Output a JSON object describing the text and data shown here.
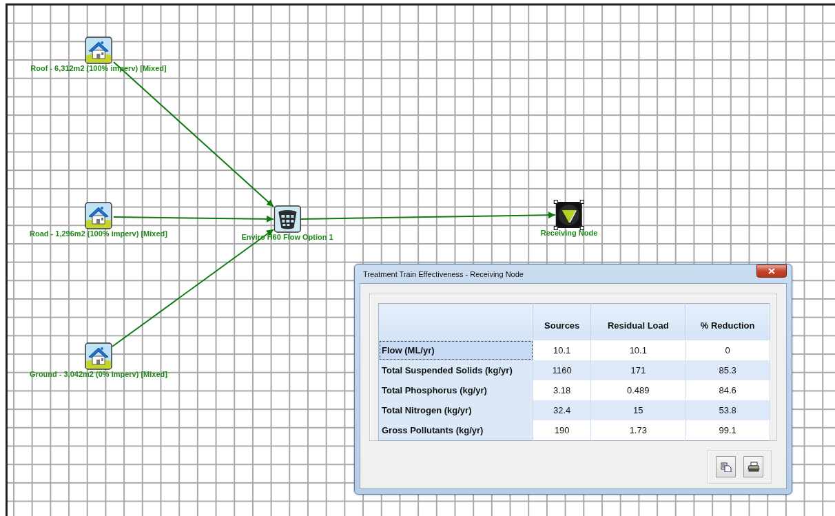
{
  "canvas": {
    "nodes": [
      {
        "kind": "catchment",
        "label": "Roof - 6,312m2 (100% imperv) [Mixed]",
        "selected": false
      },
      {
        "kind": "catchment",
        "label": "Road - 1,296m2 (100% imperv) [Mixed]",
        "selected": false
      },
      {
        "kind": "catchment",
        "label": "Ground - 3,042m2 (0% imperv) [Mixed]",
        "selected": false
      },
      {
        "kind": "treatment",
        "label": "Enviro H60 Flow Option 1",
        "selected": false
      },
      {
        "kind": "receiving",
        "label": "Receiving Node",
        "selected": true
      }
    ]
  },
  "dialog": {
    "title": "Treatment Train Effectiveness - Receiving Node",
    "table": {
      "columns": [
        "Sources",
        "Residual Load",
        "% Reduction"
      ],
      "rows": [
        {
          "label": "Flow (ML/yr)",
          "values": [
            "10.1",
            "10.1",
            "0"
          ],
          "selected": true
        },
        {
          "label": "Total Suspended Solids (kg/yr)",
          "values": [
            "1160",
            "171",
            "85.3"
          ],
          "selected": false
        },
        {
          "label": "Total Phosphorus (kg/yr)",
          "values": [
            "3.18",
            "0.489",
            "84.6"
          ],
          "selected": false
        },
        {
          "label": "Total Nitrogen (kg/yr)",
          "values": [
            "32.4",
            "15",
            "53.8"
          ],
          "selected": false
        },
        {
          "label": "Gross Pollutants (kg/yr)",
          "values": [
            "190",
            "1.73",
            "99.1"
          ],
          "selected": false
        }
      ]
    }
  }
}
